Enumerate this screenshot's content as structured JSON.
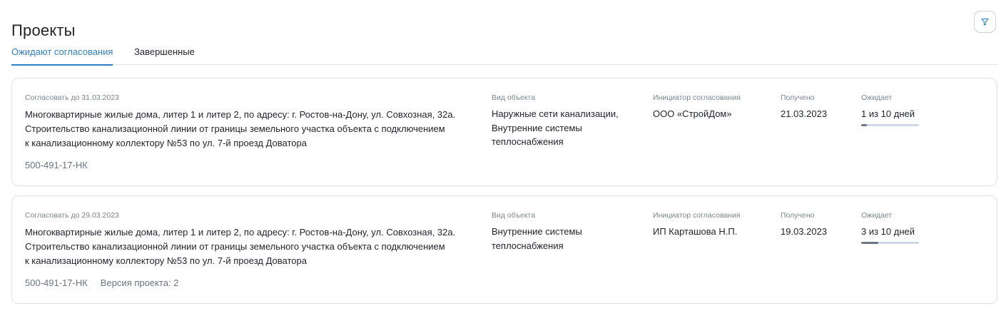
{
  "page": {
    "title": "Проекты"
  },
  "tabs": [
    {
      "label": "Ожидают согласования",
      "active": true
    },
    {
      "label": "Завершенные",
      "active": false
    }
  ],
  "colors": {
    "accent": "#2f80c4",
    "border": "#dde2e8",
    "muted_text": "#7b8590",
    "progress_track": "#cfd9e6",
    "progress_fill": "#6e7781"
  },
  "icons": {
    "filter": "filter-icon"
  },
  "projects": [
    {
      "deadline": "Согласовать до 31.03.2023",
      "description_lines": [
        "Многоквартирные жилые дома, литер 1 и литер 2, по адресу: г. Ростов-на-Дону, ул. Совхозная, 32а.",
        "Строительство канализационной линии от границы земельного участка объекта с подключением",
        "к канализационному коллектору №53 по ул. 7-й проезд Доватора"
      ],
      "code": "500-491-17-НК",
      "version": "",
      "object_type_label": "Вид объекта",
      "object_type_lines": [
        "Наружные сети канализации,",
        "Внутренние системы",
        "теплоснабжения"
      ],
      "initiator_label": "Инициатор согласования",
      "initiator": "ООО «СтройДом»",
      "received_label": "Получено",
      "received": "21.03.2023",
      "waiting_label": "Ожидает",
      "waiting": "1 из 10 дней",
      "waiting_progress": 0.1
    },
    {
      "deadline": "Согласовать до 29.03.2023",
      "description_lines": [
        "Многоквартирные жилые дома, литер 1 и литер 2, по адресу: г. Ростов-на-Дону, ул. Совхозная, 32а.",
        "Строительство канализационной линии от границы земельного участка объекта с подключением",
        "к канализационному коллектору №53 по ул. 7-й проезд Доватора"
      ],
      "code": "500-491-17-НК",
      "version": "Версия проекта: 2",
      "object_type_label": "Вид объекта",
      "object_type_lines": [
        "Внутренние системы",
        "теплоснабжения"
      ],
      "initiator_label": "Инициатор согласования",
      "initiator": "ИП Карташова Н.П.",
      "received_label": "Получено",
      "received": "19.03.2023",
      "waiting_label": "Ожидает",
      "waiting": "3 из 10 дней",
      "waiting_progress": 0.3
    }
  ]
}
